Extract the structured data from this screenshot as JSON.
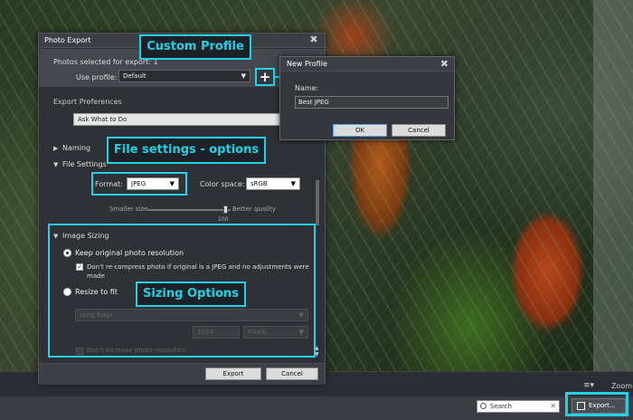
{
  "annotations": {
    "custom_profile": "Custom Profile",
    "file_settings": "File settings - options",
    "sizing_options": "Sizing Options"
  },
  "export_dialog": {
    "title": "Photo Export",
    "photos_selected": "Photos selected for export: 1",
    "use_profile_label": "Use profile:",
    "profile_value": "Default",
    "add_profile_symbol": "+",
    "export_preferences_label": "Export Preferences",
    "preferences_value": "Ask What to Do",
    "naming_label": "Naming",
    "file_settings_label": "File Settings",
    "format_label": "Format:",
    "format_value": "JPEG",
    "color_space_label": "Color space:",
    "color_space_value": "sRGB",
    "smaller_size_label": "Smaller size",
    "better_quality_label": "Better quality",
    "quality_value": "100",
    "image_sizing_label": "Image Sizing",
    "keep_original_label": "Keep original photo resolution",
    "recompress_label": "Don't re-compress photo if original is a JPEG and no adjustments were made",
    "resize_label": "Resize to fit",
    "long_edge_value": "Long Edge",
    "size_value": "1024",
    "units_value": "Pixels",
    "dont_increase_label": "Don't increase photo resolution",
    "export_button": "Export",
    "cancel_button": "Cancel"
  },
  "new_profile_dialog": {
    "title": "New Profile",
    "name_label": "Name:",
    "name_value": "Best JPEG",
    "ok_button": "OK",
    "cancel_button": "Cancel"
  },
  "toolbar": {
    "zoom_label": "Zoom:",
    "search_placeholder": "Search",
    "export_button": "Export..."
  },
  "colors": {
    "callout": "#22d1e6",
    "dialog_bg": "#2e3136"
  },
  "icons": [
    "close-icon",
    "plus-icon",
    "search-icon",
    "export-icon",
    "sort-icon",
    "chevron-down-icon"
  ]
}
